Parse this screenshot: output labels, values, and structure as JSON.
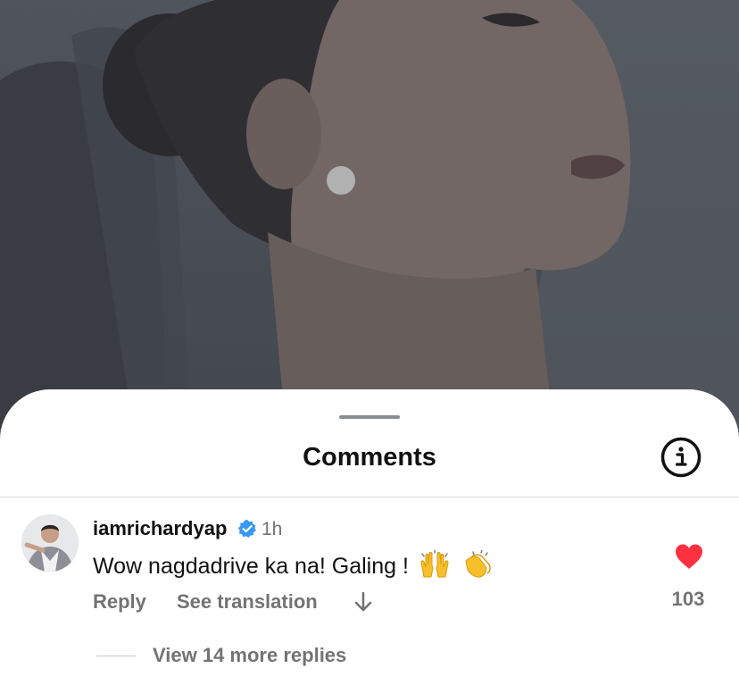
{
  "sheet": {
    "title": "Comments",
    "info_icon": "info-icon"
  },
  "comment": {
    "username": "iamrichardyap",
    "verified_icon": "verified-badge-icon",
    "time": "1h",
    "text": "Wow nagdadrive ka na! Galing !",
    "emojis": [
      "raising-hands-emoji",
      "clapping-hands-emoji"
    ],
    "reply_label": "Reply",
    "translate_label": "See translation",
    "collapse_icon": "arrow-down-icon",
    "liked": true,
    "like_icon": "heart-icon",
    "like_count": "103",
    "view_replies_label": "View 14 more replies"
  },
  "colors": {
    "like_red": "#ff3040",
    "verified_blue": "#3897f0",
    "secondary_text": "#737373"
  }
}
